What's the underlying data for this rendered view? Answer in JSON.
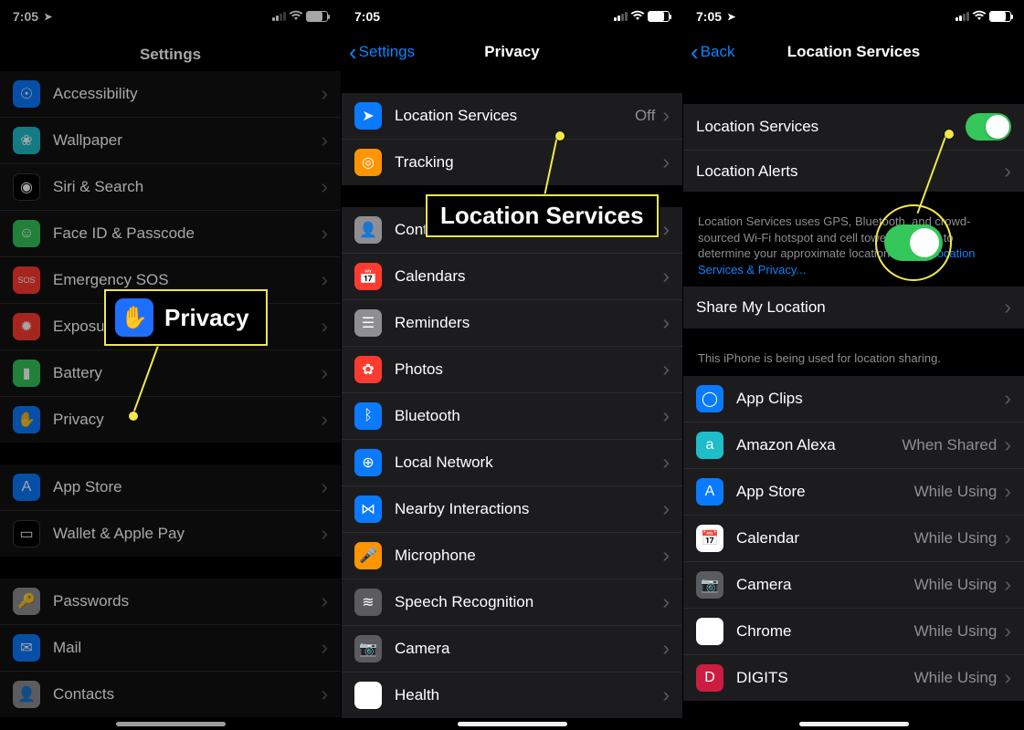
{
  "status": {
    "time": "7:05"
  },
  "screens": {
    "a": {
      "title": "Settings",
      "groups": [
        [
          {
            "label": "Accessibility",
            "color": "bg-blue",
            "glyph": "☉"
          },
          {
            "label": "Wallpaper",
            "color": "bg-teal",
            "glyph": "❀"
          },
          {
            "label": "Siri & Search",
            "color": "bg-black",
            "glyph": "◉"
          },
          {
            "label": "Face ID & Passcode",
            "color": "bg-green",
            "glyph": "☺"
          },
          {
            "label": "Emergency SOS",
            "color": "bg-red",
            "glyph": "SOS",
            "small": true
          },
          {
            "label": "Exposure Notifications",
            "color": "bg-red",
            "glyph": "✹"
          },
          {
            "label": "Battery",
            "color": "bg-green",
            "glyph": "▮"
          },
          {
            "label": "Privacy",
            "color": "bg-blue",
            "glyph": "✋"
          }
        ],
        [
          {
            "label": "App Store",
            "color": "bg-blue",
            "glyph": "A"
          },
          {
            "label": "Wallet & Apple Pay",
            "color": "bg-black",
            "glyph": "▭"
          }
        ],
        [
          {
            "label": "Passwords",
            "color": "bg-grey",
            "glyph": "🔑"
          },
          {
            "label": "Mail",
            "color": "bg-blue",
            "glyph": "✉"
          },
          {
            "label": "Contacts",
            "color": "bg-grey",
            "glyph": "👤"
          }
        ]
      ]
    },
    "b": {
      "back": "Settings",
      "title": "Privacy",
      "groups": [
        [
          {
            "label": "Location Services",
            "value": "Off",
            "color": "bg-blue",
            "glyph": "➤"
          },
          {
            "label": "Tracking",
            "color": "bg-orange",
            "glyph": "◎"
          }
        ],
        [
          {
            "label": "Contacts",
            "color": "bg-grey",
            "glyph": "👤"
          },
          {
            "label": "Calendars",
            "color": "bg-red",
            "glyph": "📅"
          },
          {
            "label": "Reminders",
            "color": "bg-grey",
            "glyph": "☰"
          },
          {
            "label": "Photos",
            "color": "bg-red",
            "glyph": "✿"
          },
          {
            "label": "Bluetooth",
            "color": "bg-blue",
            "glyph": "ᛒ"
          },
          {
            "label": "Local Network",
            "color": "bg-blue",
            "glyph": "⊕"
          },
          {
            "label": "Nearby Interactions",
            "color": "bg-blue",
            "glyph": "⋈"
          },
          {
            "label": "Microphone",
            "color": "bg-orange",
            "glyph": "🎤"
          },
          {
            "label": "Speech Recognition",
            "color": "bg-dgrey",
            "glyph": "≋"
          },
          {
            "label": "Camera",
            "color": "bg-dgrey",
            "glyph": "📷"
          },
          {
            "label": "Health",
            "color": "bg-white",
            "glyph": "♥"
          }
        ]
      ]
    },
    "c": {
      "back": "Back",
      "title": "Location Services",
      "topGroup": [
        {
          "label": "Location Services",
          "toggle": true
        },
        {
          "label": "Location Alerts"
        }
      ],
      "footer_pre": "Location Services uses GPS, Bluetooth, and crowd-sourced Wi-Fi hotspot and cell tower locations to determine your approximate location. ",
      "footer_link": "About Location Services & Privacy...",
      "shareGroup": [
        {
          "label": "Share My Location"
        }
      ],
      "share_footer": "This iPhone is being used for location sharing.",
      "apps": [
        {
          "label": "App Clips",
          "color": "bg-blue",
          "glyph": "◯",
          "value": ""
        },
        {
          "label": "Amazon Alexa",
          "color": "bg-teal",
          "glyph": "a",
          "value": "When Shared"
        },
        {
          "label": "App Store",
          "color": "bg-blue",
          "glyph": "A",
          "value": "While Using"
        },
        {
          "label": "Calendar",
          "color": "bg-white",
          "glyph": "📅",
          "value": "While Using"
        },
        {
          "label": "Camera",
          "color": "bg-dgrey",
          "glyph": "📷",
          "value": "While Using"
        },
        {
          "label": "Chrome",
          "color": "bg-white",
          "glyph": "◎",
          "value": "While Using"
        },
        {
          "label": "DIGITS",
          "color": "bg-mred",
          "glyph": "D",
          "value": "While Using"
        }
      ]
    }
  },
  "callouts": {
    "privacy": "Privacy",
    "locsvc": "Location Services"
  }
}
